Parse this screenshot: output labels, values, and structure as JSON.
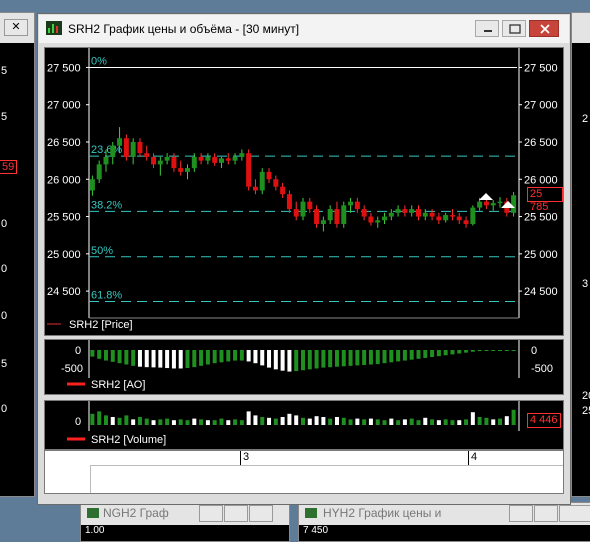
{
  "window": {
    "title": "SRH2 График цены и объёма - [30 минут]",
    "minimize_glyph": "—",
    "maximize_glyph": "□",
    "close_glyph": "✕"
  },
  "background_windows": {
    "left": {
      "values": [
        "5",
        "5",
        "59",
        "0",
        "0",
        "0",
        "5",
        "0"
      ]
    },
    "right": {
      "values": [
        "2",
        "20",
        "25",
        "3"
      ]
    },
    "bottom_left_title": "NGH2 Граф",
    "bottom_left_value": "1.00",
    "bottom_right_title": "HYH2 График цены и",
    "bottom_right_value": "7 450"
  },
  "price_panel": {
    "y_ticks": [
      "27 500",
      "27 000",
      "26 500",
      "26 000",
      "25 500",
      "25 000",
      "24 500"
    ],
    "fib_levels": [
      {
        "label": "0%",
        "price": 27500
      },
      {
        "label": "23.6%",
        "price": 26310
      },
      {
        "label": "38.2%",
        "price": 25570
      },
      {
        "label": "50%",
        "price": 24960
      },
      {
        "label": "61.8%",
        "price": 24360
      }
    ],
    "last_price": "25 785",
    "legend": "SRH2 [Price]"
  },
  "ao_panel": {
    "ticks_left": [
      "0"
    ],
    "ticks_right": [
      "0",
      "-500"
    ],
    "tick_left_500": "-500",
    "legend": "SRH2 [AO]"
  },
  "volume_panel": {
    "tick_left": "0",
    "last_volume": "4 446",
    "legend": "SRH2 [Volume]"
  },
  "date_axis": {
    "labels": [
      "3",
      "4"
    ]
  },
  "colors": {
    "up": "#1f8f1f",
    "down": "#e01010",
    "fib_line": "#36c8c0",
    "text": "#ffffff",
    "ao_white": "#ffffff",
    "ao_green": "#1f8f1f"
  },
  "chart_data": {
    "type": "candlestick",
    "y_range": [
      24300,
      27600
    ],
    "candles": [
      [
        25850,
        26050,
        25780,
        26000
      ],
      [
        26000,
        26250,
        25950,
        26200
      ],
      [
        26200,
        26400,
        26100,
        26300
      ],
      [
        26300,
        26500,
        26200,
        26450
      ],
      [
        26450,
        26700,
        26350,
        26550
      ],
      [
        26550,
        26600,
        26250,
        26300
      ],
      [
        26300,
        26550,
        26200,
        26500
      ],
      [
        26500,
        26550,
        26300,
        26350
      ],
      [
        26350,
        26450,
        26250,
        26300
      ],
      [
        26300,
        26350,
        26150,
        26200
      ],
      [
        26200,
        26300,
        26050,
        26250
      ],
      [
        26250,
        26350,
        26200,
        26300
      ],
      [
        26300,
        26350,
        26100,
        26150
      ],
      [
        26150,
        26250,
        26050,
        26100
      ],
      [
        26100,
        26200,
        26000,
        26150
      ],
      [
        26150,
        26350,
        26100,
        26300
      ],
      [
        26300,
        26350,
        26200,
        26250
      ],
      [
        26250,
        26350,
        26200,
        26300
      ],
      [
        26300,
        26350,
        26180,
        26220
      ],
      [
        26220,
        26300,
        26150,
        26280
      ],
      [
        26280,
        26350,
        26200,
        26250
      ],
      [
        26250,
        26350,
        26200,
        26300
      ],
      [
        26300,
        26400,
        26250,
        26350
      ],
      [
        26350,
        26400,
        25850,
        25900
      ],
      [
        25900,
        26000,
        25800,
        25850
      ],
      [
        25850,
        26150,
        25800,
        26100
      ],
      [
        26100,
        26150,
        25950,
        26000
      ],
      [
        26000,
        26050,
        25850,
        25900
      ],
      [
        25900,
        25950,
        25750,
        25800
      ],
      [
        25800,
        25850,
        25550,
        25600
      ],
      [
        25600,
        25700,
        25450,
        25500
      ],
      [
        25500,
        25750,
        25450,
        25700
      ],
      [
        25700,
        25750,
        25550,
        25600
      ],
      [
        25600,
        25650,
        25350,
        25400
      ],
      [
        25400,
        25500,
        25300,
        25450
      ],
      [
        25450,
        25650,
        25400,
        25600
      ],
      [
        25600,
        25700,
        25350,
        25400
      ],
      [
        25400,
        25700,
        25350,
        25650
      ],
      [
        25650,
        25750,
        25550,
        25700
      ],
      [
        25700,
        25750,
        25550,
        25600
      ],
      [
        25600,
        25650,
        25450,
        25500
      ],
      [
        25500,
        25550,
        25380,
        25420
      ],
      [
        25420,
        25500,
        25350,
        25450
      ],
      [
        25450,
        25550,
        25400,
        25500
      ],
      [
        25500,
        25600,
        25450,
        25550
      ],
      [
        25550,
        25650,
        25500,
        25600
      ],
      [
        25600,
        25650,
        25500,
        25550
      ],
      [
        25550,
        25650,
        25500,
        25600
      ],
      [
        25600,
        25650,
        25450,
        25500
      ],
      [
        25500,
        25600,
        25450,
        25550
      ],
      [
        25550,
        25600,
        25450,
        25500
      ],
      [
        25500,
        25550,
        25400,
        25450
      ],
      [
        25450,
        25550,
        25420,
        25520
      ],
      [
        25520,
        25600,
        25450,
        25500
      ],
      [
        25500,
        25550,
        25400,
        25450
      ],
      [
        25450,
        25500,
        25350,
        25400
      ],
      [
        25400,
        25650,
        25380,
        25620
      ],
      [
        25620,
        25750,
        25580,
        25700
      ],
      [
        25700,
        25760,
        25600,
        25650
      ],
      [
        25650,
        25720,
        25580,
        25680
      ],
      [
        25680,
        25760,
        25620,
        25700
      ],
      [
        25700,
        25750,
        25500,
        25550
      ],
      [
        25550,
        25830,
        25500,
        25785
      ]
    ],
    "ao": [
      -150,
      -200,
      -240,
      -270,
      -300,
      -330,
      -360,
      -380,
      -390,
      -395,
      -400,
      -410,
      -420,
      -420,
      -410,
      -390,
      -360,
      -330,
      -300,
      -280,
      -260,
      -240,
      -240,
      -260,
      -300,
      -350,
      -400,
      -440,
      -470,
      -490,
      -480,
      -460,
      -440,
      -420,
      -400,
      -390,
      -380,
      -370,
      -360,
      -350,
      -340,
      -330,
      -320,
      -300,
      -280,
      -260,
      -240,
      -220,
      -200,
      -180,
      -160,
      -140,
      -120,
      -100,
      -80,
      -60,
      -40,
      -25,
      -15,
      -8,
      -4,
      -2,
      -1
    ],
    "ao_colors": [
      "g",
      "g",
      "g",
      "g",
      "g",
      "g",
      "g",
      "w",
      "w",
      "w",
      "w",
      "w",
      "w",
      "w",
      "g",
      "g",
      "g",
      "g",
      "g",
      "g",
      "g",
      "g",
      "g",
      "w",
      "w",
      "w",
      "w",
      "w",
      "w",
      "w",
      "g",
      "g",
      "g",
      "g",
      "g",
      "g",
      "g",
      "g",
      "g",
      "g",
      "g",
      "g",
      "g",
      "g",
      "g",
      "g",
      "g",
      "g",
      "g",
      "g",
      "g",
      "g",
      "g",
      "g",
      "g",
      "g",
      "g",
      "g",
      "g",
      "g",
      "g",
      "g",
      "g"
    ],
    "volume": [
      0.7,
      0.85,
      0.6,
      0.5,
      0.45,
      0.6,
      0.35,
      0.5,
      0.4,
      0.3,
      0.35,
      0.4,
      0.3,
      0.35,
      0.3,
      0.4,
      0.35,
      0.3,
      0.3,
      0.4,
      0.3,
      0.35,
      0.3,
      0.85,
      0.6,
      0.5,
      0.45,
      0.4,
      0.5,
      0.7,
      0.6,
      0.45,
      0.4,
      0.55,
      0.5,
      0.4,
      0.5,
      0.45,
      0.35,
      0.4,
      0.35,
      0.4,
      0.35,
      0.3,
      0.4,
      0.3,
      0.35,
      0.4,
      0.3,
      0.45,
      0.35,
      0.3,
      0.35,
      0.3,
      0.3,
      0.35,
      0.8,
      0.5,
      0.45,
      0.35,
      0.4,
      0.55,
      0.95
    ],
    "volume_colors": [
      "g",
      "g",
      "g",
      "w",
      "g",
      "g",
      "w",
      "g",
      "g",
      "w",
      "g",
      "g",
      "w",
      "g",
      "g",
      "w",
      "g",
      "w",
      "g",
      "g",
      "w",
      "g",
      "g",
      "w",
      "w",
      "g",
      "w",
      "g",
      "w",
      "w",
      "w",
      "g",
      "w",
      "w",
      "w",
      "g",
      "w",
      "g",
      "g",
      "w",
      "g",
      "w",
      "g",
      "g",
      "w",
      "g",
      "w",
      "g",
      "g",
      "w",
      "g",
      "w",
      "g",
      "g",
      "w",
      "g",
      "w",
      "g",
      "g",
      "w",
      "g",
      "w",
      "g"
    ]
  }
}
